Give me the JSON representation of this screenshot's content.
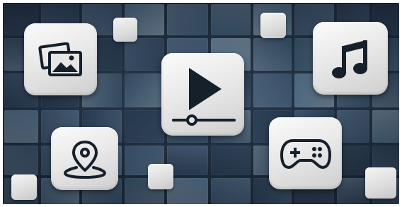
{
  "scene": {
    "background_color": "#233346",
    "button_color": "#e6e6e6",
    "icon_color": "#16202b"
  },
  "buttons": [
    {
      "id": "gallery",
      "icon": "photo-gallery-icon"
    },
    {
      "id": "video",
      "icon": "play-video-icon"
    },
    {
      "id": "music",
      "icon": "music-note-icon"
    },
    {
      "id": "location",
      "icon": "location-pin-icon"
    },
    {
      "id": "game",
      "icon": "gamepad-icon"
    }
  ],
  "decorative_chips": 5
}
